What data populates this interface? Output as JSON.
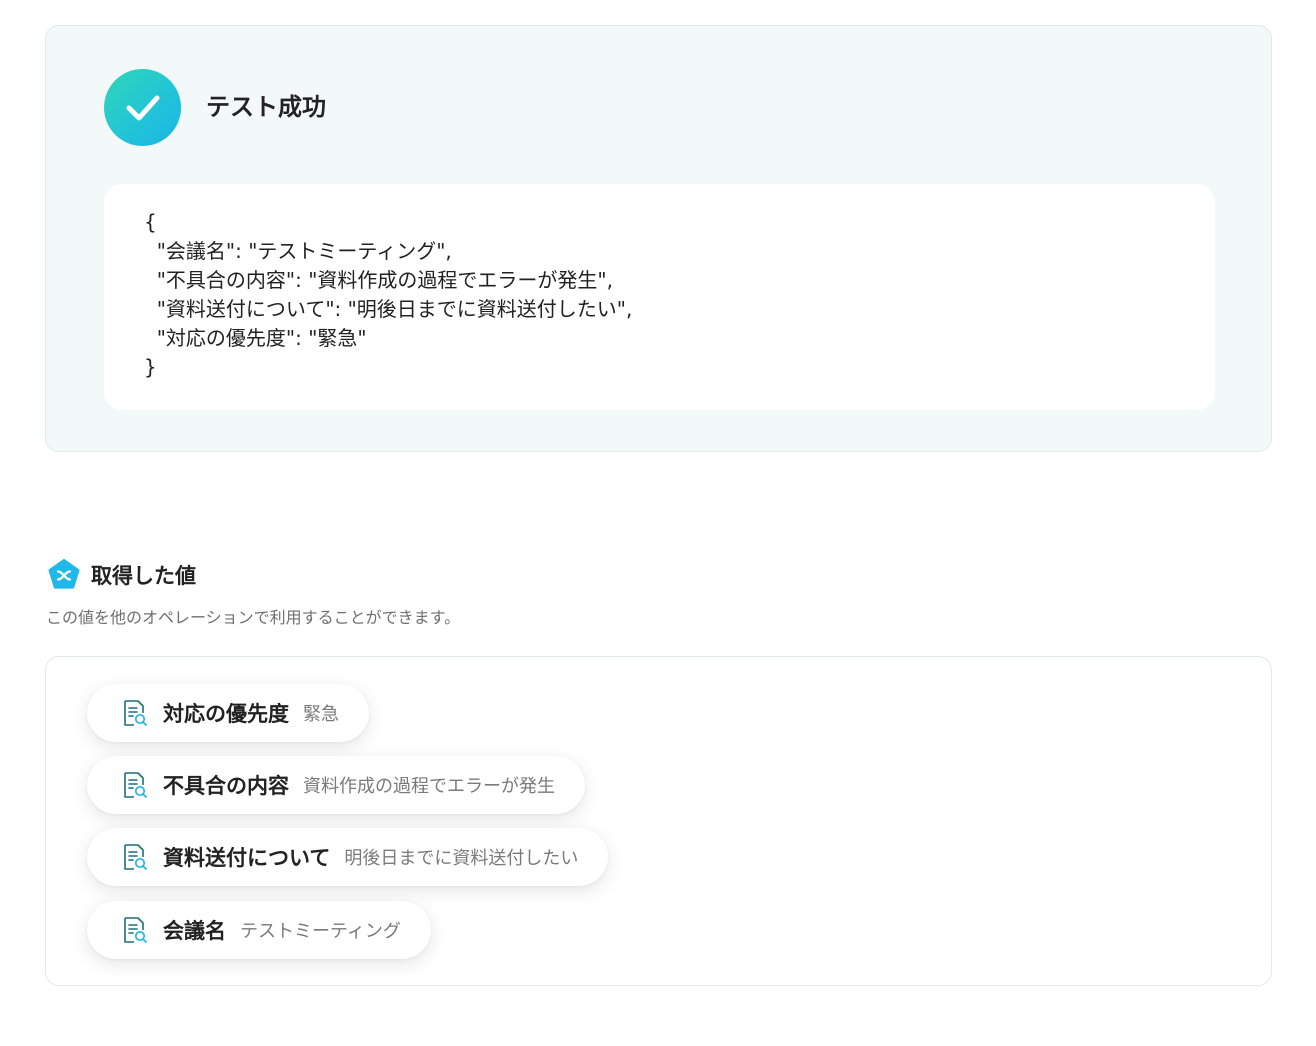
{
  "result": {
    "status_title": "テスト成功",
    "json_output": "{\n  \"会議名\": \"テストミーティング\",\n  \"不具合の内容\": \"資料作成の過程でエラーが発生\",\n  \"資料送付について\": \"明後日までに資料送付したい\",\n  \"対応の優先度\": \"緊急\"\n}"
  },
  "retrieved": {
    "title": "取得した値",
    "description": "この値を他のオペレーションで利用することができます。",
    "items": [
      {
        "label": "対応の優先度",
        "value": "緊急"
      },
      {
        "label": "不具合の内容",
        "value": "資料作成の過程でエラーが発生"
      },
      {
        "label": "資料送付について",
        "value": "明後日までに資料送付したい"
      },
      {
        "label": "会議名",
        "value": "テストミーティング"
      }
    ]
  },
  "colors": {
    "accent_start": "#2fd6b8",
    "accent_end": "#1ab4e6",
    "icon_blue": "#1fb8e8",
    "icon_stroke": "#1f6f7a"
  },
  "icons": {
    "success": "check-circle-icon",
    "section": "variable-pentagon-icon",
    "item": "document-search-icon"
  }
}
